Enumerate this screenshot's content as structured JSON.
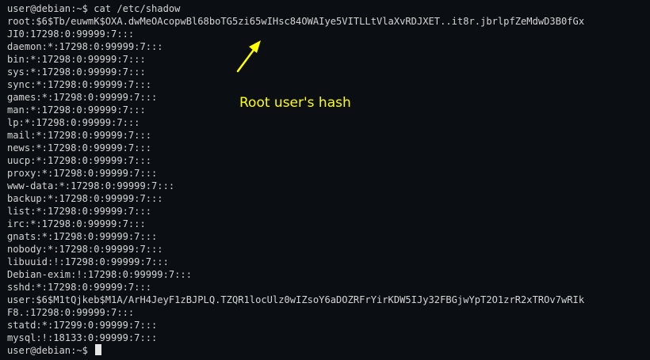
{
  "terminal": {
    "lines": [
      "user@debian:~$ cat /etc/shadow",
      "root:$6$Tb/euwmK$OXA.dwMeOAcopwBl68boTG5zi65wIHsc84OWAIye5VITLLtVlaXvRDJXET..it8r.jbrlpfZeMdwD3B0fGx",
      "JI0:17298:0:99999:7:::",
      "daemon:*:17298:0:99999:7:::",
      "bin:*:17298:0:99999:7:::",
      "sys:*:17298:0:99999:7:::",
      "sync:*:17298:0:99999:7:::",
      "games:*:17298:0:99999:7:::",
      "man:*:17298:0:99999:7:::",
      "lp:*:17298:0:99999:7:::",
      "mail:*:17298:0:99999:7:::",
      "news:*:17298:0:99999:7:::",
      "uucp:*:17298:0:99999:7:::",
      "proxy:*:17298:0:99999:7:::",
      "www-data:*:17298:0:99999:7:::",
      "backup:*:17298:0:99999:7:::",
      "list:*:17298:0:99999:7:::",
      "irc:*:17298:0:99999:7:::",
      "gnats:*:17298:0:99999:7:::",
      "nobody:*:17298:0:99999:7:::",
      "libuuid:!:17298:0:99999:7:::",
      "Debian-exim:!:17298:0:99999:7:::",
      "sshd:*:17298:0:99999:7:::",
      "user:$6$M1tQjkeb$M1A/ArH4JeyF1zBJPLQ.TZQR1locUlz0wIZsoY6aDOZRFrYirKDW5IJy32FBGjwYpT2O1zrR2xTROv7wRIk",
      "F8.:17298:0:99999:7:::",
      "statd:*:17299:0:99999:7:::",
      "mysql:!:18133:0:99999:7:::"
    ],
    "prompt": "user@debian:~$ "
  },
  "annotation": {
    "text": "Root user's hash",
    "color": "#ffff00"
  }
}
